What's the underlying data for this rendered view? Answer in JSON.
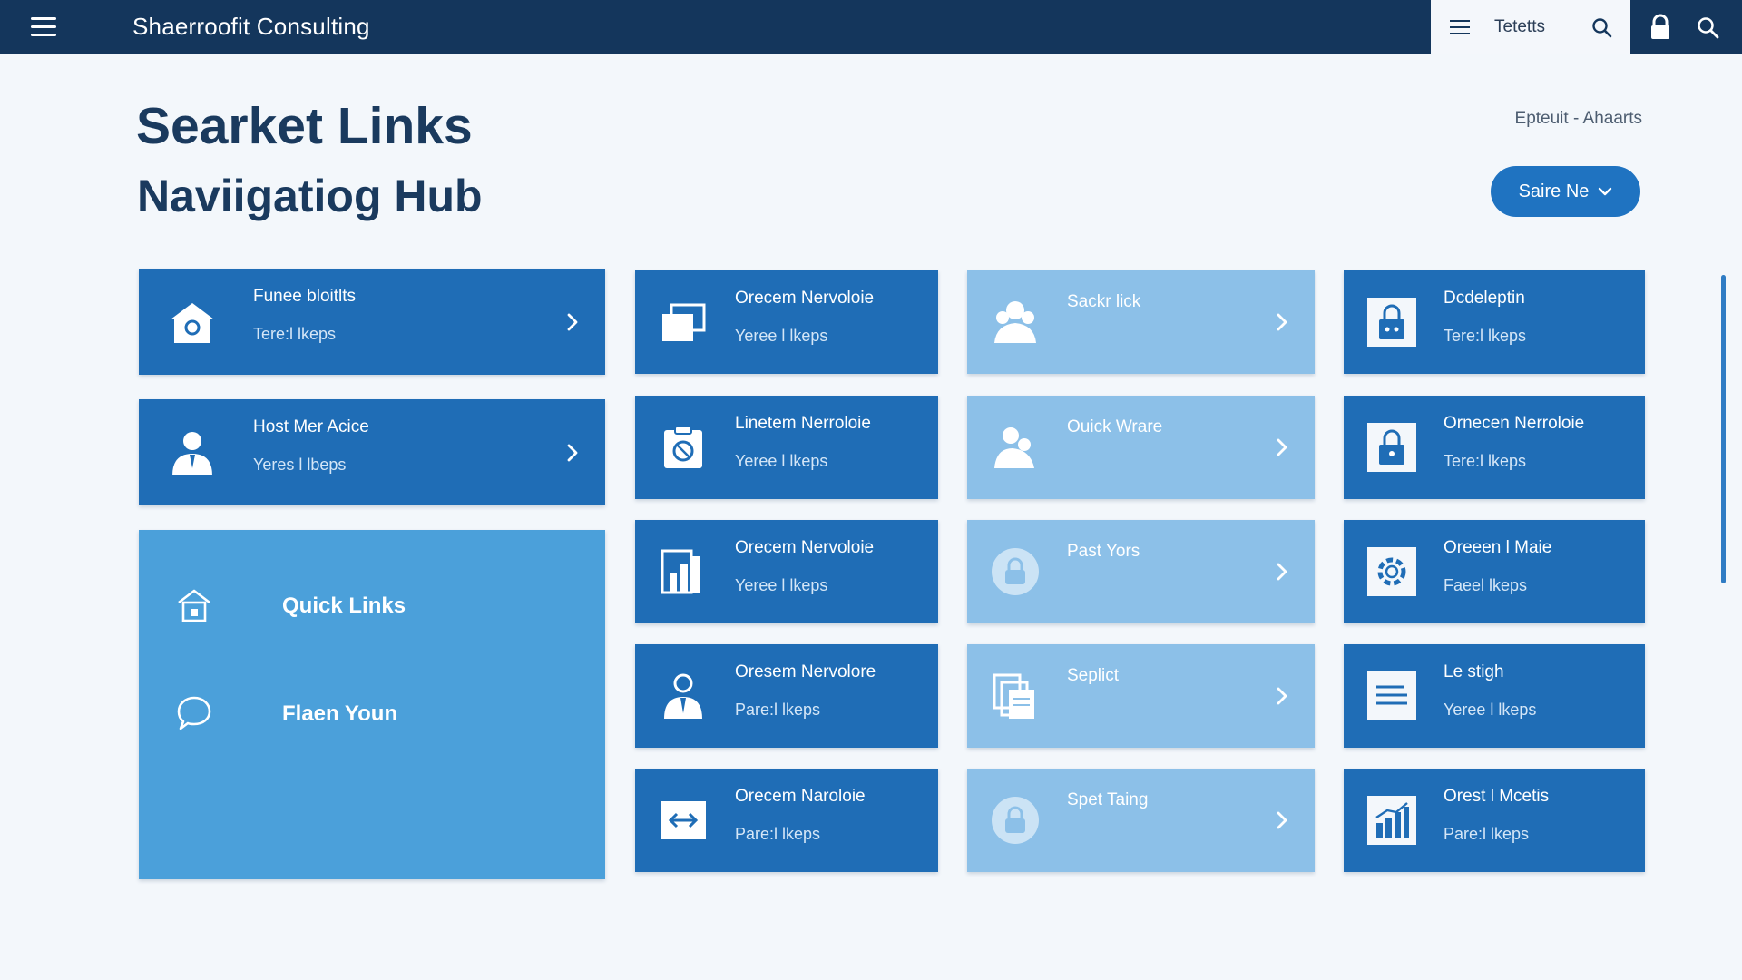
{
  "app": {
    "brand": "Shaerroofit Consulting"
  },
  "top_panel": {
    "label": "Tetetts"
  },
  "page": {
    "title_line1": "Searket Links",
    "title_line2": "Naviigatiog Hub"
  },
  "breadcrumb": {
    "first": "Epteuit",
    "separator": "-",
    "second": "Ahaarts"
  },
  "save_button": {
    "label": "Saire Ne"
  },
  "colors": {
    "topbar": "#14365c",
    "card_dark": "#1f6db6",
    "card_light": "#8cc0e8",
    "quick_panel": "#4ba0da",
    "button": "#1f73c1"
  },
  "wide_cards": [
    {
      "title": "Funee bloitlts",
      "subtitle": "Tere:l lkeps",
      "icon": "home-icon"
    },
    {
      "title": "Host Mer Acice",
      "subtitle": "Yeres l lbeps",
      "icon": "user-icon"
    }
  ],
  "quick_panel": {
    "items": [
      {
        "label": "Quick Links",
        "icon": "home-icon"
      },
      {
        "label": "Flaen Youn",
        "icon": "chat-icon"
      }
    ]
  },
  "col2": [
    {
      "title": "Orecem Nervoloie",
      "subtitle": "Yeree l lkeps",
      "icon": "windows-icon"
    },
    {
      "title": "Linetem Nerroloie",
      "subtitle": "Yeree l lkeps",
      "icon": "clipboard-icon"
    },
    {
      "title": "Orecem Nervoloie",
      "subtitle": "Yeree l lkeps",
      "icon": "bar-chart-icon"
    },
    {
      "title": "Oresem Nervolore",
      "subtitle": "Pare:l lkeps",
      "icon": "user-icon"
    },
    {
      "title": "Orecem Naroloie",
      "subtitle": "Pare:l lkeps",
      "icon": "arrows-icon"
    }
  ],
  "col3": [
    {
      "title": "Sackr lick",
      "icon": "users-icon"
    },
    {
      "title": "Ouick Wrare",
      "icon": "users-icon"
    },
    {
      "title": "Past Yors",
      "icon": "lock-icon"
    },
    {
      "title": "Seplict",
      "icon": "documents-icon"
    },
    {
      "title": "Spet Taing",
      "icon": "lock-icon"
    }
  ],
  "col4": [
    {
      "title": "Dcdeleptin",
      "subtitle": "Tere:l lkeps",
      "icon": "lock-icon"
    },
    {
      "title": "Ornecen Nerroloie",
      "subtitle": "Tere:l lkeps",
      "icon": "lock-icon"
    },
    {
      "title": "Oreeen l Maie",
      "subtitle": "Faeel lkeps",
      "icon": "gear-icon"
    },
    {
      "title": "Le stigh",
      "subtitle": "Yeree l lkeps",
      "icon": "document-icon"
    },
    {
      "title": "Orest l Mcetis",
      "subtitle": "Pare:l lkeps",
      "icon": "bar-chart-icon"
    }
  ]
}
